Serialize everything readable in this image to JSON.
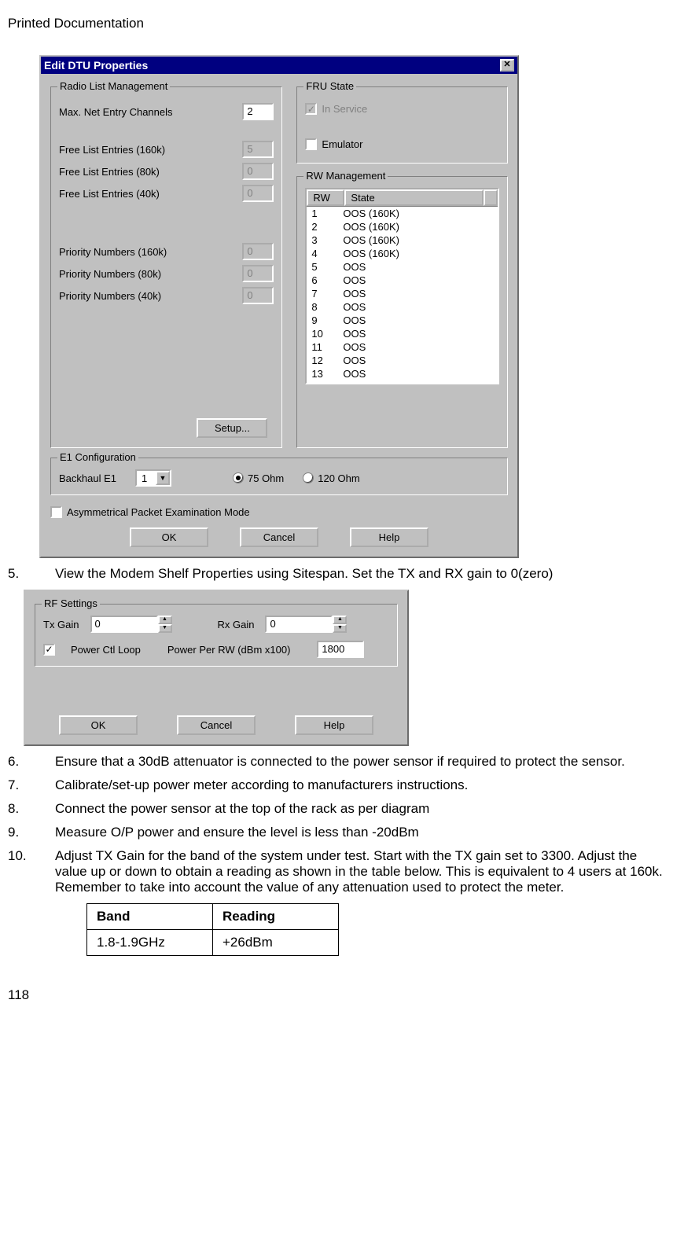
{
  "doc": {
    "header": "Printed Documentation",
    "page_number": "118"
  },
  "steps": {
    "s5": {
      "num": "5.",
      "text": "View the Modem Shelf Properties using Sitespan.  Set the TX and RX gain to 0(zero)"
    },
    "s6": {
      "num": "6.",
      "text": "Ensure that a 30dB attenuator is connected to the power sensor if required to protect the sensor."
    },
    "s7": {
      "num": "7.",
      "text": "Calibrate/set-up power meter according to manufacturers instructions."
    },
    "s8": {
      "num": "8.",
      "text": "Connect the power sensor at the top of the rack as per diagram"
    },
    "s9": {
      "num": "9.",
      "text": "Measure O/P power and ensure the level is less than -20dBm"
    },
    "s10": {
      "num": "10.",
      "text": "Adjust TX Gain for the band of the system under test. Start with the TX gain set to 3300. Adjust the value up or down to obtain a reading as shown in the table below. This is equivalent to 4 users at 160k. Remember to take into account the value of any attenuation used to protect the meter."
    }
  },
  "table": {
    "headers": {
      "band": "Band",
      "reading": "Reading"
    },
    "rows": [
      {
        "band": "1.8-1.9GHz",
        "reading": "+26dBm"
      }
    ]
  },
  "dtu": {
    "title": "Edit DTU Properties",
    "close_glyph": "✕",
    "group_rlm": "Radio List Management",
    "lbl_maxnet": "Max. Net Entry Channels",
    "val_maxnet": "2",
    "lbl_fle160": "Free List Entries (160k)",
    "val_fle160": "5",
    "lbl_fle80": "Free List Entries (80k)",
    "val_fle80": "0",
    "lbl_fle40": "Free List Entries (40k)",
    "val_fle40": "0",
    "lbl_pn160": "Priority Numbers (160k)",
    "val_pn160": "0",
    "lbl_pn80": "Priority Numbers (80k)",
    "val_pn80": "0",
    "lbl_pn40": "Priority Numbers (40k)",
    "val_pn40": "0",
    "btn_setup": "Setup...",
    "group_fru": "FRU State",
    "chk_inservice": "In Service",
    "chk_emulator": "Emulator",
    "group_rwm": "RW Management",
    "rw_header_rw": "RW",
    "rw_header_state": "State",
    "rw_rows": [
      {
        "rw": "1",
        "state": "OOS (160K)"
      },
      {
        "rw": "2",
        "state": "OOS (160K)"
      },
      {
        "rw": "3",
        "state": "OOS (160K)"
      },
      {
        "rw": "4",
        "state": "OOS (160K)"
      },
      {
        "rw": "5",
        "state": "OOS"
      },
      {
        "rw": "6",
        "state": "OOS"
      },
      {
        "rw": "7",
        "state": "OOS"
      },
      {
        "rw": "8",
        "state": "OOS"
      },
      {
        "rw": "9",
        "state": "OOS"
      },
      {
        "rw": "10",
        "state": "OOS"
      },
      {
        "rw": "11",
        "state": "OOS"
      },
      {
        "rw": "12",
        "state": "OOS"
      },
      {
        "rw": "13",
        "state": "OOS"
      }
    ],
    "group_e1": "E1 Configuration",
    "lbl_backhaul": "Backhaul E1",
    "val_backhaul": "1",
    "radio_75": "75 Ohm",
    "radio_120": "120 Ohm",
    "chk_asym": "Asymmetrical Packet Examination Mode",
    "btn_ok": "OK",
    "btn_cancel": "Cancel",
    "btn_help": "Help"
  },
  "rf": {
    "group_title": "RF Settings",
    "lbl_tx": "Tx Gain",
    "val_tx": "0",
    "lbl_rx": "Rx Gain",
    "val_rx": "0",
    "chk_pcl": "Power Ctl Loop",
    "lbl_ppr": "Power Per RW (dBm x100)",
    "val_ppr": "1800",
    "btn_ok": "OK",
    "btn_cancel": "Cancel",
    "btn_help": "Help"
  }
}
